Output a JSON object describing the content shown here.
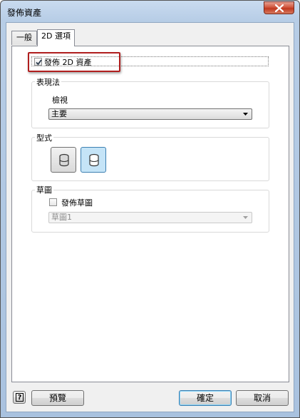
{
  "window": {
    "title": "發佈資產"
  },
  "tabs": [
    {
      "label": "一般"
    },
    {
      "label": "2D 選項"
    }
  ],
  "publish_2d": {
    "label": "發佈 2D 資產",
    "checked": true
  },
  "representation": {
    "group_label": "表現法",
    "view_label": "檢視",
    "view_value": "主要"
  },
  "style": {
    "group_label": "型式",
    "selected_index": 1
  },
  "sketch": {
    "group_label": "草圖",
    "publish_label": "發佈草圖",
    "publish_checked": false,
    "sketch_value": "草圖1"
  },
  "footer": {
    "help_label": "?",
    "preview_label": "預覽",
    "ok_label": "確定",
    "cancel_label": "取消"
  },
  "colors": {
    "highlight_border": "#b01e1e",
    "selected_style_fill": "#c5e4f7"
  },
  "icons": {
    "style_buttons": [
      "cylinder-shaded-icon",
      "cylinder-outline-icon"
    ]
  }
}
